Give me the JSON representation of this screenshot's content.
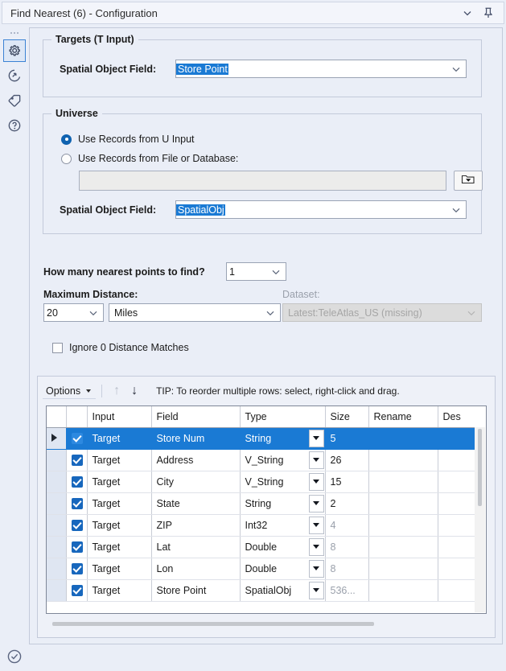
{
  "window": {
    "title": "Find Nearest (6) - Configuration",
    "collapse_icon": "chevron-down-icon",
    "pin_icon": "pin-icon"
  },
  "rail": {
    "drag_handle": "dots-handle",
    "items": [
      {
        "name": "gear-icon",
        "selected": true
      },
      {
        "name": "refresh-arrow-icon",
        "selected": false
      },
      {
        "name": "tag-icon",
        "selected": false
      },
      {
        "name": "help-icon",
        "selected": false
      }
    ],
    "status_icon": "check-circle-icon"
  },
  "targets_group": {
    "legend": "Targets (T Input)",
    "spatial_object_field_label": "Spatial Object Field:",
    "spatial_object_field_value": "Store Point",
    "caret_icon": "chevron-down-icon"
  },
  "universe_group": {
    "legend": "Universe",
    "radio_u_input": "Use Records from U Input",
    "radio_file_db": "Use Records from File or Database:",
    "selected_radio": "u_input",
    "file_path_value": "",
    "browse_icon": "folder-dropdown-icon",
    "spatial_object_field_label": "Spatial Object Field:",
    "spatial_object_field_value": "SpatialObj",
    "caret_icon": "chevron-down-icon"
  },
  "options": {
    "nearest_points_label": "How many nearest points to find?",
    "nearest_points_value": "1",
    "max_distance_label": "Maximum Distance:",
    "max_distance_value": "20",
    "units_value": "Miles",
    "dataset_label": "Dataset:",
    "dataset_value": "Latest:TeleAtlas_US (missing)",
    "ignore_zero_label": "Ignore 0 Distance Matches",
    "ignore_zero_checked": false
  },
  "toolbar": {
    "options_label": "Options",
    "options_caret": "caret-down-icon",
    "move_up_icon": "arrow-up-icon",
    "move_up_glyph": "↑",
    "move_down_icon": "arrow-down-icon",
    "move_down_glyph": "↓",
    "tip": "TIP: To reorder multiple rows: select, right-click and drag."
  },
  "grid": {
    "columns": [
      "",
      "",
      "Input",
      "Field",
      "Type",
      "Size",
      "Rename",
      "Des"
    ],
    "rows": [
      {
        "selected": true,
        "checked": true,
        "input": "Target",
        "field": "Store Num",
        "type": "String",
        "size": "5",
        "size_dim": false,
        "rename": "",
        "des": ""
      },
      {
        "selected": false,
        "checked": true,
        "input": "Target",
        "field": "Address",
        "type": "V_String",
        "size": "26",
        "size_dim": false,
        "rename": "",
        "des": ""
      },
      {
        "selected": false,
        "checked": true,
        "input": "Target",
        "field": "City",
        "type": "V_String",
        "size": "15",
        "size_dim": false,
        "rename": "",
        "des": ""
      },
      {
        "selected": false,
        "checked": true,
        "input": "Target",
        "field": "State",
        "type": "String",
        "size": "2",
        "size_dim": false,
        "rename": "",
        "des": ""
      },
      {
        "selected": false,
        "checked": true,
        "input": "Target",
        "field": "ZIP",
        "type": "Int32",
        "size": "4",
        "size_dim": true,
        "rename": "",
        "des": ""
      },
      {
        "selected": false,
        "checked": true,
        "input": "Target",
        "field": "Lat",
        "type": "Double",
        "size": "8",
        "size_dim": true,
        "rename": "",
        "des": ""
      },
      {
        "selected": false,
        "checked": true,
        "input": "Target",
        "field": "Lon",
        "type": "Double",
        "size": "8",
        "size_dim": true,
        "rename": "",
        "des": ""
      },
      {
        "selected": false,
        "checked": true,
        "input": "Target",
        "field": "Store Point",
        "type": "SpatialObj",
        "size": "536...",
        "size_dim": true,
        "rename": "",
        "des": ""
      }
    ]
  },
  "colors": {
    "accent": "#1a7ad4",
    "panel_bg": "#eaeef7",
    "checkbox_blue": "#1767bd",
    "radio_blue": "#0f62b0"
  }
}
